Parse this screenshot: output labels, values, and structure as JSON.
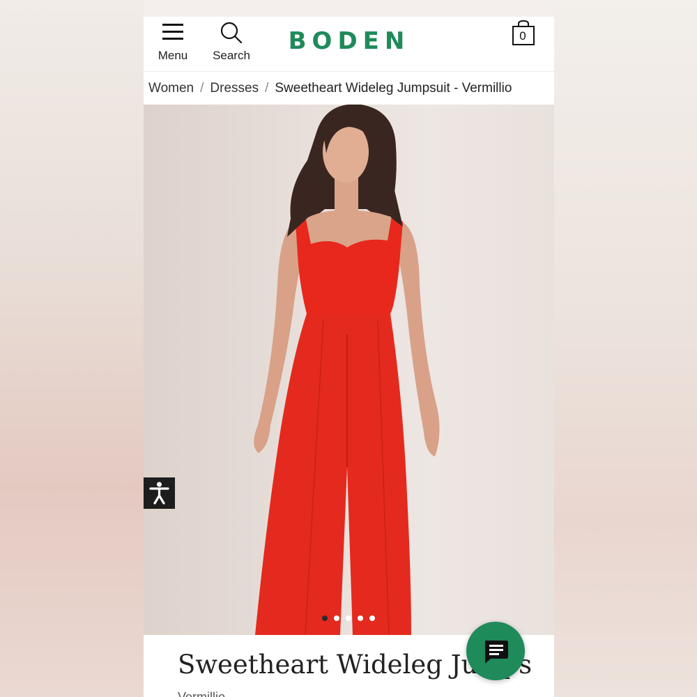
{
  "header": {
    "menu_label": "Menu",
    "search_label": "Search",
    "brand": "BODEN",
    "bag_count": "0"
  },
  "breadcrumb": {
    "items": [
      "Women",
      "Dresses"
    ],
    "separator": "/",
    "current": "Sweetheart Wideleg Jumpsuit - Vermillio"
  },
  "product": {
    "title": "Sweetheart Wideleg Jumps",
    "subtitle": "Vermillio",
    "image_count": 5,
    "active_image_index": 0
  },
  "icons": {
    "menu": "hamburger-icon",
    "search": "search-icon",
    "bag": "shopping-bag-icon",
    "accessibility": "accessibility-icon",
    "chat": "chat-icon"
  },
  "colors": {
    "brand_green": "#1f8a5a",
    "jumpsuit_red": "#e8281c"
  }
}
